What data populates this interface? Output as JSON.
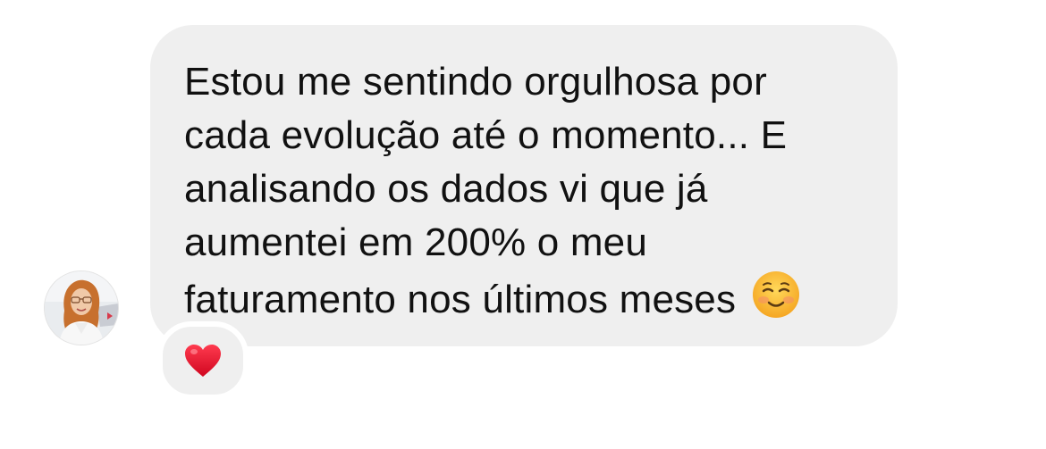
{
  "message": {
    "lines": [
      "Estou me sentindo orgulhosa por",
      "cada evolução até o momento... E",
      "analisando os dados vi que já",
      "aumentei em 200% o meu",
      "faturamento nos últimos meses"
    ],
    "trailing_emoji": "smiling-face-icon"
  },
  "avatar": {
    "icon": "user-avatar"
  },
  "reaction": {
    "icon": "red-heart-icon",
    "color": "#e8112d"
  },
  "colors": {
    "bubble": "#efefef",
    "text": "#111111",
    "background": "#ffffff"
  }
}
